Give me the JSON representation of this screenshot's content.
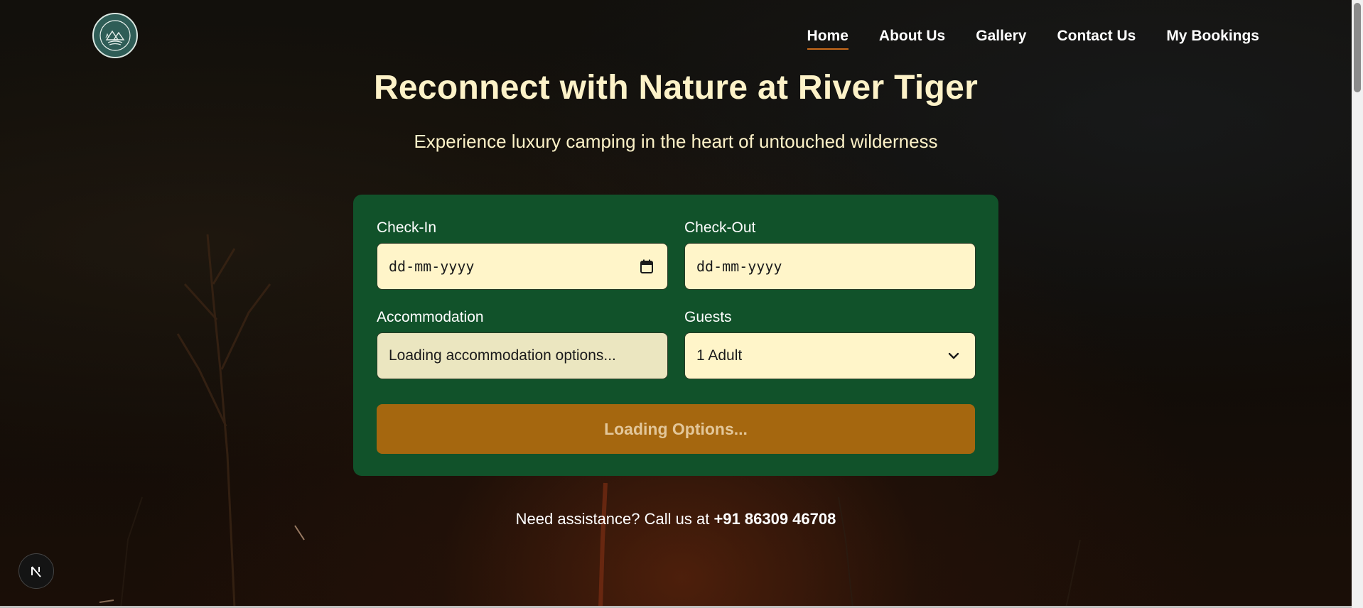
{
  "header": {
    "logo_alt": "River Tiger",
    "nav": [
      {
        "label": "Home",
        "active": true
      },
      {
        "label": "About Us",
        "active": false
      },
      {
        "label": "Gallery",
        "active": false
      },
      {
        "label": "Contact Us",
        "active": false
      },
      {
        "label": "My Bookings",
        "active": false
      }
    ]
  },
  "hero": {
    "title": "Reconnect with Nature at River Tiger",
    "subtitle": "Experience luxury camping in the heart of untouched wilderness"
  },
  "booking": {
    "checkin_label": "Check-In",
    "checkin_value": "dd-mm-yyyy",
    "checkout_label": "Check-Out",
    "checkout_value": "dd-mm-yyyy",
    "accommodation_label": "Accommodation",
    "accommodation_value": "Loading accommodation options...",
    "guests_label": "Guests",
    "guests_value": "1 Adult",
    "submit_label": "Loading Options..."
  },
  "assistance": {
    "text": "Need assistance? Call us at ",
    "phone": "+91 86309 46708"
  },
  "colors": {
    "card_bg": "#11522a",
    "accent_button": "#a5670f",
    "heading_cream": "#fdf2c8",
    "input_bg": "#fff5c9",
    "nav_underline": "#c86a1a"
  },
  "icons": {
    "logo": "river-tiger-logo-icon",
    "checkin": "calendar-icon",
    "guests": "chevron-down-icon",
    "corner": "next-logo-icon"
  }
}
